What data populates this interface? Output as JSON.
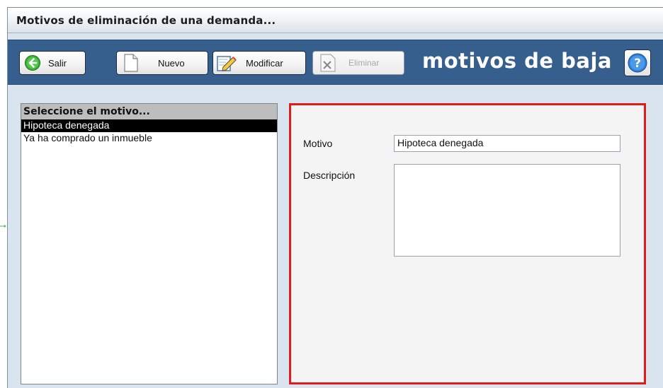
{
  "window": {
    "title": "Motivos de eliminación de una demanda..."
  },
  "toolbar": {
    "salir_label": "Salir",
    "nuevo_label": "Nuevo",
    "modificar_label": "Modificar",
    "eliminar_label": "Eliminar",
    "heading": "motivos de baja",
    "bg_color": "#365f8e"
  },
  "list": {
    "header": "Seleccione el motivo...",
    "items": [
      {
        "label": "Hipoteca denegada",
        "selected": true
      },
      {
        "label": "Ya ha comprado un inmueble",
        "selected": false
      }
    ]
  },
  "form": {
    "motivo_label": "Motivo",
    "motivo_value": "Hipoteca denegada",
    "descripcion_label": "Descripción",
    "descripcion_value": "",
    "border_color": "#e11a1a"
  },
  "icons": {
    "salir": "back-arrow-icon",
    "nuevo": "new-document-icon",
    "modificar": "edit-pencil-icon",
    "eliminar": "delete-x-icon",
    "help": "help-question-icon"
  }
}
